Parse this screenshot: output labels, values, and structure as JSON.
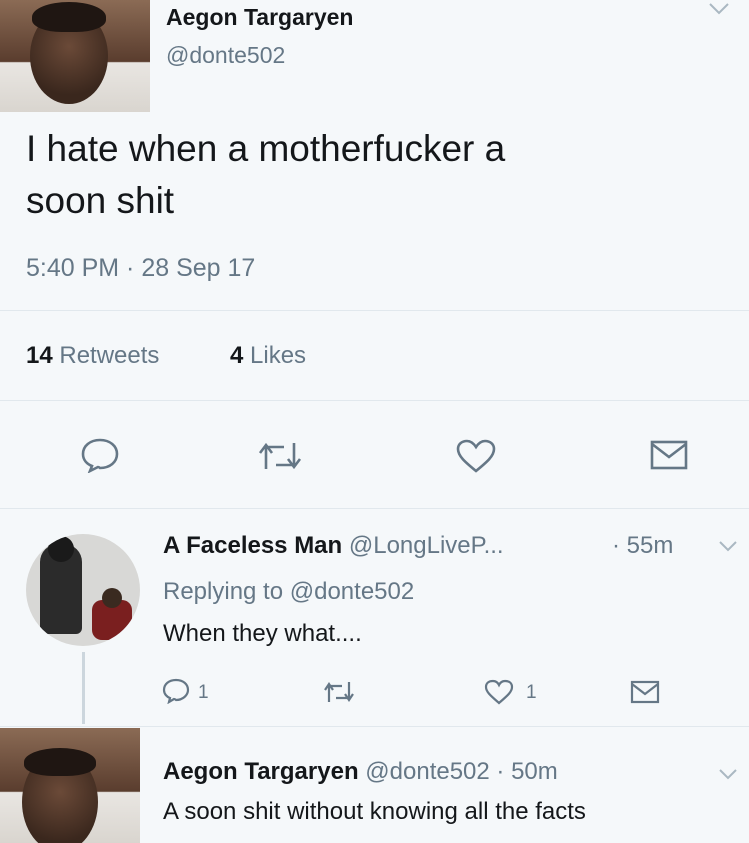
{
  "main_tweet": {
    "display_name": "Aegon Targaryen",
    "handle": "@donte502",
    "text_line1": "I hate when a motherfucker a",
    "text_line2": "soon shit",
    "timestamp": "5:40 PM · 28 Sep 17",
    "retweets_count": "14",
    "retweets_label": "Retweets",
    "likes_count": "4",
    "likes_label": "Likes"
  },
  "reply1": {
    "display_name": "A Faceless Man",
    "handle": "@LongLiveP...",
    "time": "· 55m",
    "replying_to": "Replying to @donte502",
    "text": "When they what....",
    "reply_count": "1",
    "like_count": "1"
  },
  "reply2": {
    "display_name": "Aegon Targaryen",
    "handle": "@donte502",
    "time": "· 50m",
    "text": "A soon shit without knowing all the facts"
  },
  "icons": [
    "reply-icon",
    "retweet-icon",
    "heart-icon",
    "message-icon",
    "chevron-down-icon"
  ],
  "colors": {
    "text": "#14171a",
    "muted": "#657786",
    "background": "#f5f8fa",
    "border": "#e1e8ed"
  }
}
